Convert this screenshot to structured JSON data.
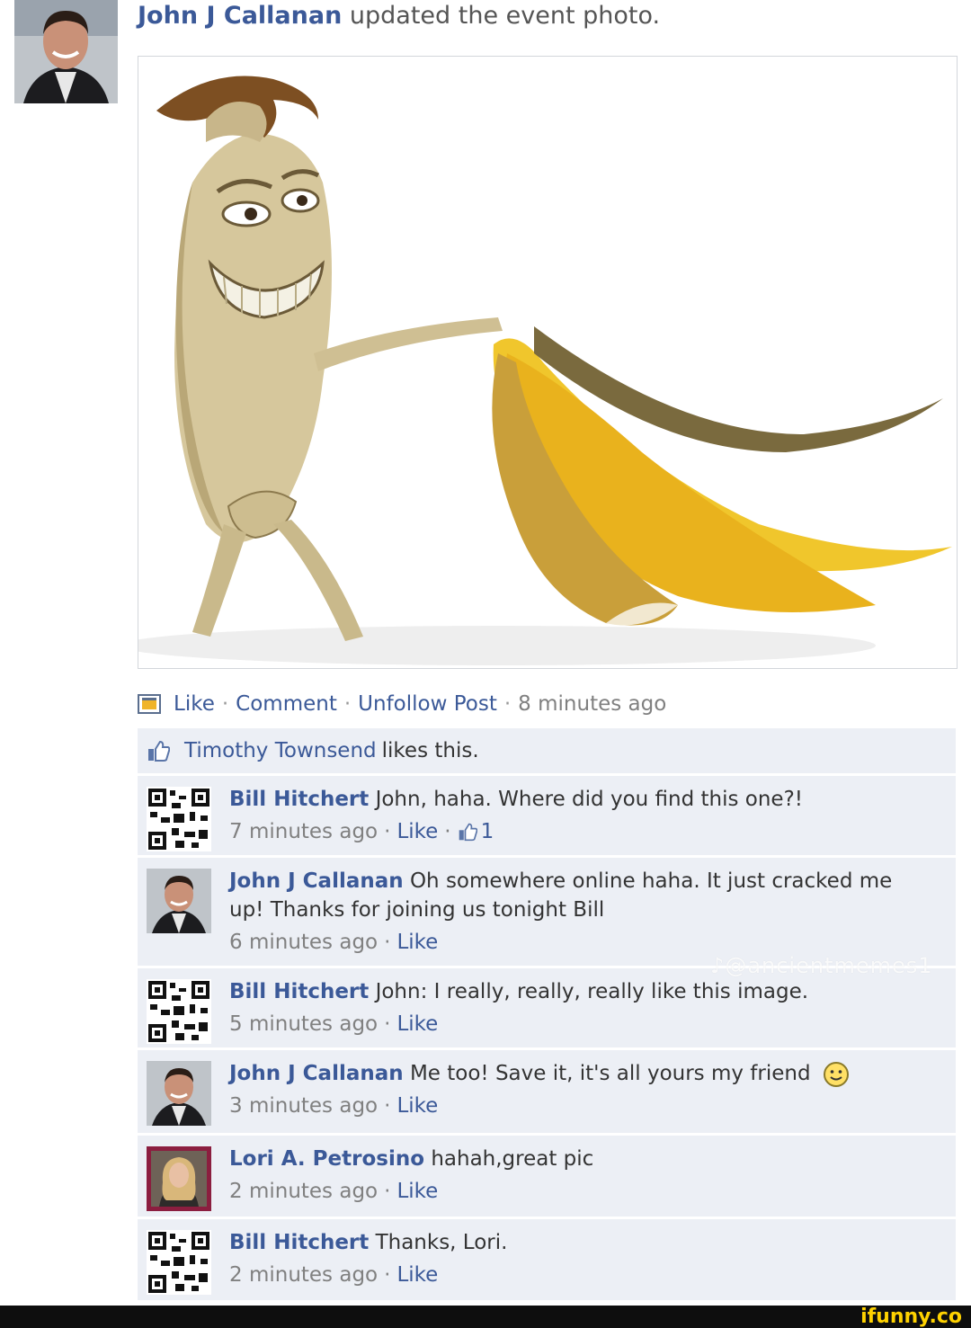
{
  "post": {
    "author": "John J Callanan",
    "action": "updated the event photo.",
    "photo_alt": "event photo"
  },
  "actions": {
    "like": "Like",
    "comment": "Comment",
    "unfollow": "Unfollow Post",
    "separator": "·",
    "time": "8 minutes ago"
  },
  "likes": {
    "name": "Timothy Townsend",
    "text": "likes this."
  },
  "comments": [
    {
      "author": "Bill Hitchert",
      "text": "John, haha. Where did you find this one?!",
      "time": "7 minutes ago",
      "like": "Like",
      "like_count": "1",
      "avatar": "qr-code"
    },
    {
      "author": "John J Callanan",
      "text": "Oh somewhere online haha. It just cracked me up! Thanks for joining us tonight Bill",
      "time": "6 minutes ago",
      "like": "Like",
      "avatar": "man-photo"
    },
    {
      "author": "Bill Hitchert",
      "text": "John: I really, really, really like this image.",
      "time": "5 minutes ago",
      "like": "Like",
      "avatar": "qr-code"
    },
    {
      "author": "John J Callanan",
      "text": "Me too! Save it, it's all yours my friend",
      "time": "3 minutes ago",
      "like": "Like",
      "avatar": "man-photo"
    },
    {
      "author": "Lori A. Petrosino",
      "text": "hahah,great pic",
      "time": "2 minutes ago",
      "like": "Like",
      "avatar": "woman-photo"
    },
    {
      "author": "Bill Hitchert",
      "text": "Thanks, Lori.",
      "time": "2 minutes ago",
      "like": "Like",
      "avatar": "qr-code"
    }
  ],
  "watermark": "♪@ancientmemes1",
  "footer": {
    "brand": "ifunny.co"
  },
  "colors": {
    "link": "#3b5998",
    "feedback_bg": "#eceff5",
    "meta": "#808080",
    "brand": "#ffd200"
  }
}
